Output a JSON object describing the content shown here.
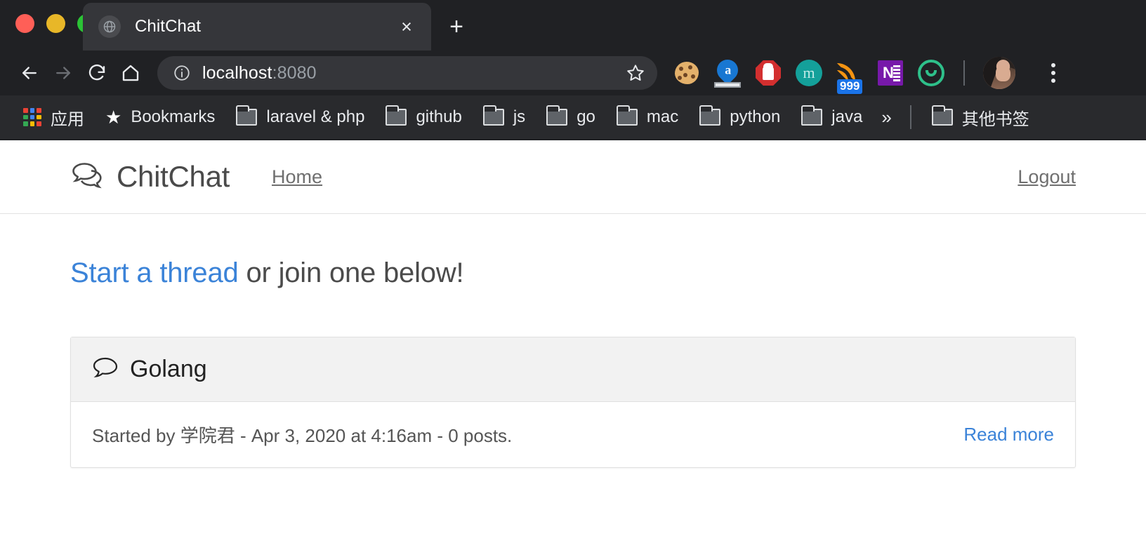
{
  "browser": {
    "tab": {
      "title": "ChitChat",
      "favicon": "globe-icon",
      "close": "×"
    },
    "new_tab_label": "+",
    "nav": {
      "back": "back-arrow-icon",
      "forward": "forward-arrow-icon",
      "reload": "reload-icon",
      "home": "home-icon"
    },
    "omnibox": {
      "host": "localhost",
      "port": ":8080",
      "info_icon": "page-info-icon",
      "bookmark_icon": "star-icon"
    },
    "extensions": [
      {
        "name": "cookie-extension-icon",
        "label": ""
      },
      {
        "name": "amazon-extension-icon",
        "label": "a"
      },
      {
        "name": "adblock-stop-hand-icon",
        "label": ""
      },
      {
        "name": "m-circle-extension-icon",
        "label": "m"
      },
      {
        "name": "rss-feed-extension-icon",
        "label": "",
        "badge": "999"
      },
      {
        "name": "onenote-extension-icon",
        "label": "N"
      },
      {
        "name": "green-smile-extension-icon",
        "label": ""
      }
    ],
    "profile_avatar": "user-avatar",
    "menu_icon": "kebab-menu-icon",
    "bookmarks": [
      {
        "label": "应用",
        "icon": "apps-grid-icon"
      },
      {
        "label": "Bookmarks",
        "icon": "star-icon"
      },
      {
        "label": "laravel & php",
        "icon": "folder-icon"
      },
      {
        "label": "github",
        "icon": "folder-icon"
      },
      {
        "label": "js",
        "icon": "folder-icon"
      },
      {
        "label": "go",
        "icon": "folder-icon"
      },
      {
        "label": "mac",
        "icon": "folder-icon"
      },
      {
        "label": "python",
        "icon": "folder-icon"
      },
      {
        "label": "java",
        "icon": "folder-icon"
      }
    ],
    "bookmarks_overflow": "»",
    "other_bookmarks": {
      "label": "其他书签",
      "icon": "folder-icon"
    }
  },
  "site": {
    "brand": {
      "name": "ChitChat",
      "icon": "double-speech-bubble-icon"
    },
    "nav": {
      "home": "Home",
      "logout": "Logout"
    },
    "lede": {
      "link": "Start a thread",
      "rest": " or join one below!"
    },
    "threads": [
      {
        "title": "Golang",
        "icon": "speech-bubble-icon",
        "meta": "Started by 学院君 - Apr 3, 2020 at 4:16am - 0 posts.",
        "link": "Read more"
      }
    ]
  },
  "colors": {
    "chrome_bg": "#202124",
    "bookmarks_bg": "#292a2d",
    "tab_active": "#35363a",
    "link_blue": "#3b83d8",
    "card_head": "#f2f2f2"
  }
}
